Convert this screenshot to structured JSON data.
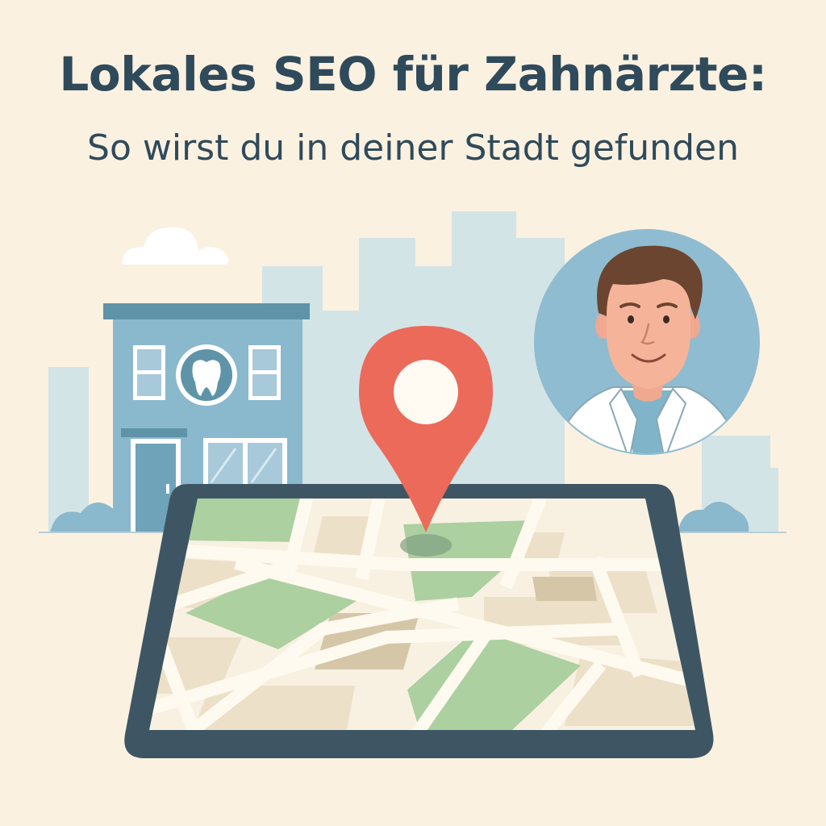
{
  "header": {
    "title": "Lokales SEO für Zahnärzte:",
    "subtitle": "So wirst du in deiner Stadt gefunden"
  },
  "illustration": {
    "icons": [
      "cloud-icon",
      "tooth-icon",
      "location-pin-icon",
      "dentist-avatar",
      "tablet-map"
    ]
  },
  "colors": {
    "background": "#fbf1e1",
    "text": "#2f4a5a",
    "skyline": "#d3e4e6",
    "building": "#8ab8cd",
    "pin": "#ec6a5a",
    "park": "#acd0a0",
    "block": "#ede0c8",
    "tablet_frame": "#3e5664"
  }
}
